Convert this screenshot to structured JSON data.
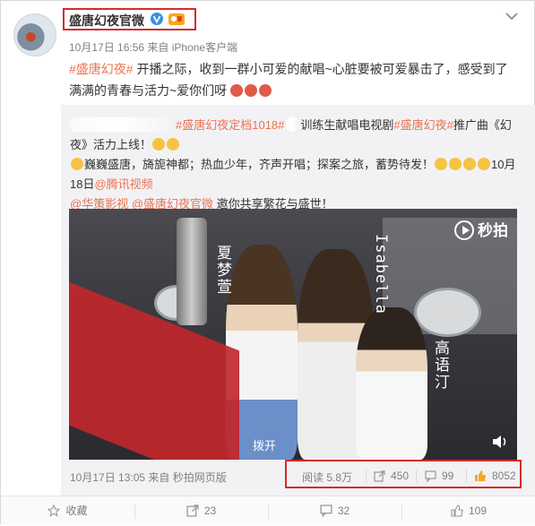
{
  "author": {
    "name": "盛唐幻夜官微"
  },
  "meta": {
    "time_source": "10月17日 16:56 来自 iPhone客户端"
  },
  "post": {
    "hashtag": "#盛唐幻夜#",
    "body_line1": " 开播之际，收到一群小可爱的献唱~心脏要被可爱暴击了，感受到了",
    "body_line2": "满满的青春与活力~爱你们呀"
  },
  "repost": {
    "tag1": "#盛唐幻夜定档1018#",
    "after_tag1": "训练生献唱电视剧",
    "tag2": "#盛唐幻夜#",
    "after_tag2": "推广曲《幻夜》活力上线！",
    "line2a": "巍巍盛唐，旖旎神都；热血少年，齐声开唱；探案之旅，蓄势待发！",
    "line2b": "10月18日",
    "mention1": "@腾讯视频",
    "mention2": "@华策影视",
    "mention3": "@盛唐幻夜官微",
    "line3": " 邀你共享繁花与盛世！",
    "time_source": "10月17日 13:05 来自 秒拍网页版",
    "reads": "阅读 5.8万",
    "reposts": "450",
    "comments": "99",
    "likes": "8052"
  },
  "video": {
    "logo": "秒拍",
    "name1": "夏梦萱",
    "name2": "Isabella",
    "name3": "高语汀",
    "subtitle": "拨开"
  },
  "actions": {
    "favorite": "收藏",
    "repost": "23",
    "comment": "32",
    "like": "109"
  },
  "colors": {
    "link": "#eb7350",
    "highlight_box": "#d62b2b"
  },
  "icons": [
    "menu-chevron-icon",
    "verified-v-icon",
    "gold-badge-icon",
    "play-logo-icon",
    "volume-icon",
    "favorite-icon",
    "repost-icon",
    "comment-icon",
    "like-icon"
  ]
}
